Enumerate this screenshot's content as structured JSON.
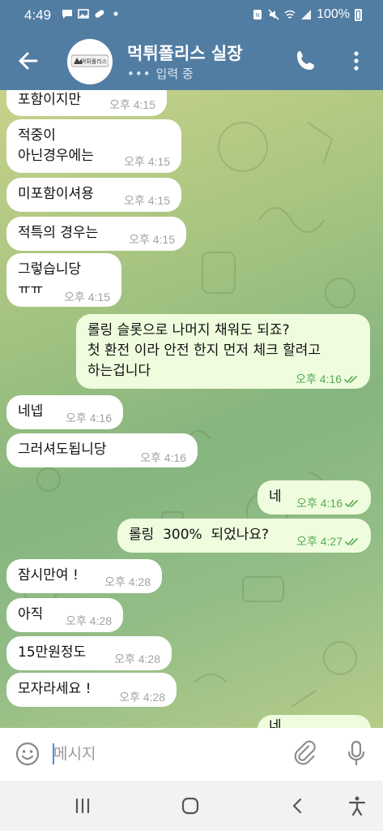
{
  "status_bar": {
    "time": "4:49",
    "battery": "100%",
    "left_icons": [
      "chat-notification-icon",
      "image-notification-icon",
      "pill-notification-icon",
      "dot-icon"
    ],
    "right_icons": [
      "nfc-icon",
      "mute-icon",
      "wifi-icon",
      "signal-icon",
      "battery-icon"
    ]
  },
  "header": {
    "title": "먹튀폴리스 실장",
    "status": "입력 중",
    "avatar_text": "먹튀폴리스"
  },
  "messages": [
    {
      "dir": "in",
      "text": "포함이지만",
      "time": "오후 4:15"
    },
    {
      "dir": "in",
      "text": "적중이\n아닌경우에는",
      "time": "오후 4:15"
    },
    {
      "dir": "in",
      "text": "미포함이셔용",
      "time": "오후 4:15"
    },
    {
      "dir": "in",
      "text": "적특의 경우는",
      "time": "오후 4:15"
    },
    {
      "dir": "in",
      "text": "그렇습니당\nㅠㅠ",
      "time": "오후 4:15"
    },
    {
      "dir": "out",
      "text": "롤링 슬롯으로 나머지 채워도 되죠?\n첫 환전 이라 안전 한지 먼저 체크 할려고\n하는겁니다",
      "time": "오후 4:16"
    },
    {
      "dir": "in",
      "text": "네넵",
      "time": "오후 4:16"
    },
    {
      "dir": "in",
      "text": "그러셔도됩니당",
      "time": "오후 4:16"
    },
    {
      "dir": "out",
      "text": "네",
      "time": "오후 4:16"
    },
    {
      "dir": "out",
      "text": "롤링  300%  되었나요?",
      "time": "오후 4:27"
    },
    {
      "dir": "in",
      "text": "잠시만여 !",
      "time": "오후 4:28"
    },
    {
      "dir": "in",
      "text": "아직",
      "time": "오후 4:28"
    },
    {
      "dir": "in",
      "text": "15만원정도",
      "time": "오후 4:28"
    },
    {
      "dir": "in",
      "text": "모자라세요 !",
      "time": "오후 4:28"
    },
    {
      "dir": "out",
      "text": "네",
      "time": ""
    }
  ],
  "input": {
    "placeholder": "메시지"
  },
  "colors": {
    "header": "#527da3",
    "incoming_bubble": "#ffffff",
    "outgoing_bubble": "#effdde",
    "outgoing_time": "#58a954",
    "incoming_time": "#a3a3a3"
  },
  "nav_bar": {
    "buttons": [
      "recent-apps-icon",
      "home-icon",
      "back-icon",
      "accessibility-icon"
    ]
  }
}
